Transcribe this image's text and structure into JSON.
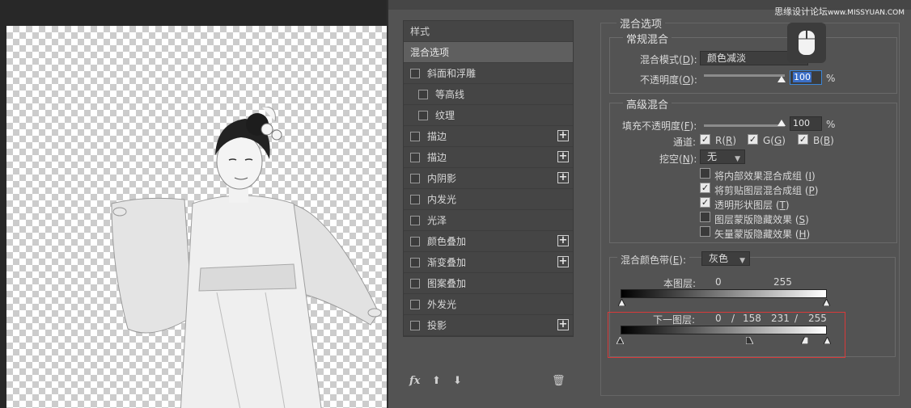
{
  "watermark": {
    "text": "思缘设计论坛",
    "url": "www.MISSYUAN.COM"
  },
  "styles_panel": {
    "header": "样式",
    "items": [
      {
        "label": "混合选项",
        "active": true,
        "checkbox": false,
        "plus": false,
        "indent": false
      },
      {
        "label": "斜面和浮雕",
        "checkbox": true,
        "plus": false,
        "indent": false
      },
      {
        "label": "等高线",
        "checkbox": true,
        "plus": false,
        "indent": true
      },
      {
        "label": "纹理",
        "checkbox": true,
        "plus": false,
        "indent": true
      },
      {
        "label": "描边",
        "checkbox": true,
        "plus": true,
        "indent": false
      },
      {
        "label": "描边",
        "checkbox": true,
        "plus": true,
        "indent": false
      },
      {
        "label": "内阴影",
        "checkbox": true,
        "plus": true,
        "indent": false
      },
      {
        "label": "内发光",
        "checkbox": true,
        "plus": false,
        "indent": false
      },
      {
        "label": "光泽",
        "checkbox": true,
        "plus": false,
        "indent": false
      },
      {
        "label": "颜色叠加",
        "checkbox": true,
        "plus": true,
        "indent": false
      },
      {
        "label": "渐变叠加",
        "checkbox": true,
        "plus": true,
        "indent": false
      },
      {
        "label": "图案叠加",
        "checkbox": true,
        "plus": false,
        "indent": false
      },
      {
        "label": "外发光",
        "checkbox": true,
        "plus": false,
        "indent": false
      },
      {
        "label": "投影",
        "checkbox": true,
        "plus": true,
        "indent": false
      }
    ],
    "footer_fx": "fx"
  },
  "blending": {
    "title": "混合选项",
    "general": {
      "title": "常规混合",
      "mode_label": "混合模式(",
      "mode_key": "D",
      "mode_value": "颜色减淡",
      "opacity_label": "不透明度(",
      "opacity_key": "O",
      "opacity_value": "100",
      "opacity_unit": "%"
    },
    "advanced": {
      "title": "高级混合",
      "fill_label": "填充不透明度(",
      "fill_key": "F",
      "fill_value": "100",
      "fill_unit": "%",
      "channels_label": "通道:",
      "channels": [
        {
          "label": "R(",
          "key": "R",
          "checked": true
        },
        {
          "label": "G(",
          "key": "G",
          "checked": true
        },
        {
          "label": "B(",
          "key": "B",
          "checked": true
        }
      ],
      "knockout_label": "挖空(",
      "knockout_key": "N",
      "knockout_value": "无",
      "options": [
        {
          "label": "将内部效果混合成组 (",
          "key": "I",
          "checked": false
        },
        {
          "label": "将剪贴图层混合成组 (",
          "key": "P",
          "checked": true
        },
        {
          "label": "透明形状图层 (",
          "key": "T",
          "checked": true
        },
        {
          "label": "图层蒙版隐藏效果 (",
          "key": "S",
          "checked": false
        },
        {
          "label": "矢量蒙版隐藏效果 (",
          "key": "H",
          "checked": false
        }
      ]
    },
    "blend_if": {
      "label": "混合颜色带(",
      "key": "E",
      "value": "灰色",
      "this_layer_label": "本图层:",
      "this_layer_min": "0",
      "this_layer_max": "255",
      "under_layer_label": "下一图层:",
      "under_layer_values": [
        "0",
        "/",
        "158",
        "231",
        "/",
        "255"
      ]
    }
  }
}
